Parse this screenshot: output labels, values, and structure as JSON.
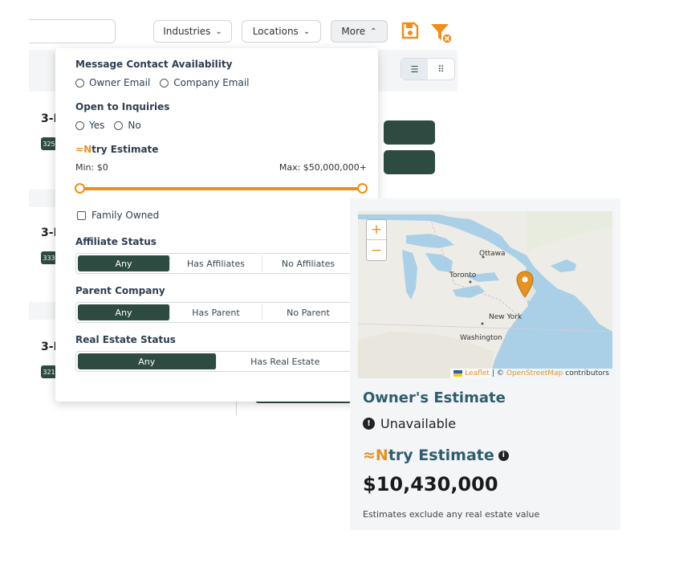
{
  "toolbar": {
    "industries_label": "Industries",
    "locations_label": "Locations",
    "more_label": "More",
    "save_icon": "save-icon",
    "filter_clear_icon": "filter-clear-icon",
    "accent_color": "#ef8f1a",
    "primary_color": "#2e4b41"
  },
  "background_list": {
    "cards": [
      {
        "title": "3-I",
        "badge": "325"
      },
      {
        "title": "3-I",
        "badge": "333"
      },
      {
        "title": "3-I",
        "badge": "321"
      }
    ]
  },
  "filters": {
    "message_contact": {
      "label": "Message Contact Availability",
      "options": [
        "Owner Email",
        "Company Email"
      ]
    },
    "open_to_inquiries": {
      "label": "Open to Inquiries",
      "options": [
        "Yes",
        "No"
      ]
    },
    "ntry_estimate": {
      "label_prefix": "≈",
      "label_brand": "N",
      "label_rest": "try Estimate",
      "min_label": "Min: $0",
      "max_label": "Max: $50,000,000+",
      "range_min_fraction": 0,
      "range_max_fraction": 1
    },
    "family_owned": {
      "label": "Family Owned",
      "checked": false
    },
    "affiliate_status": {
      "label": "Affiliate Status",
      "options": [
        "Any",
        "Has Affiliates",
        "No Affiliates"
      ],
      "selected": "Any"
    },
    "parent_company": {
      "label": "Parent Company",
      "options": [
        "Any",
        "Has Parent",
        "No Parent"
      ],
      "selected": "Any"
    },
    "real_estate_status": {
      "label": "Real Estate Status",
      "options": [
        "Any",
        "Has Real Estate"
      ],
      "selected": "Any"
    }
  },
  "map": {
    "zoom_in": "+",
    "zoom_out": "−",
    "cities": {
      "ottawa": "Ottawa",
      "toronto": "Toronto",
      "new_york": "New York",
      "washington": "Washington"
    },
    "attribution_leaflet": "Leaflet",
    "attribution_sep": "| ©",
    "attribution_osm": "OpenStreetMap",
    "attribution_tail": "contributors",
    "marker_icon": "map-pin-icon"
  },
  "estimate": {
    "owner_title": "Owner's Estimate",
    "owner_status": "Unavailable",
    "ntry_prefix": "≈",
    "ntry_brand": "N",
    "ntry_rest": "try Estimate",
    "ntry_value": "$10,430,000",
    "footnote": "Estimates exclude any real estate value"
  }
}
